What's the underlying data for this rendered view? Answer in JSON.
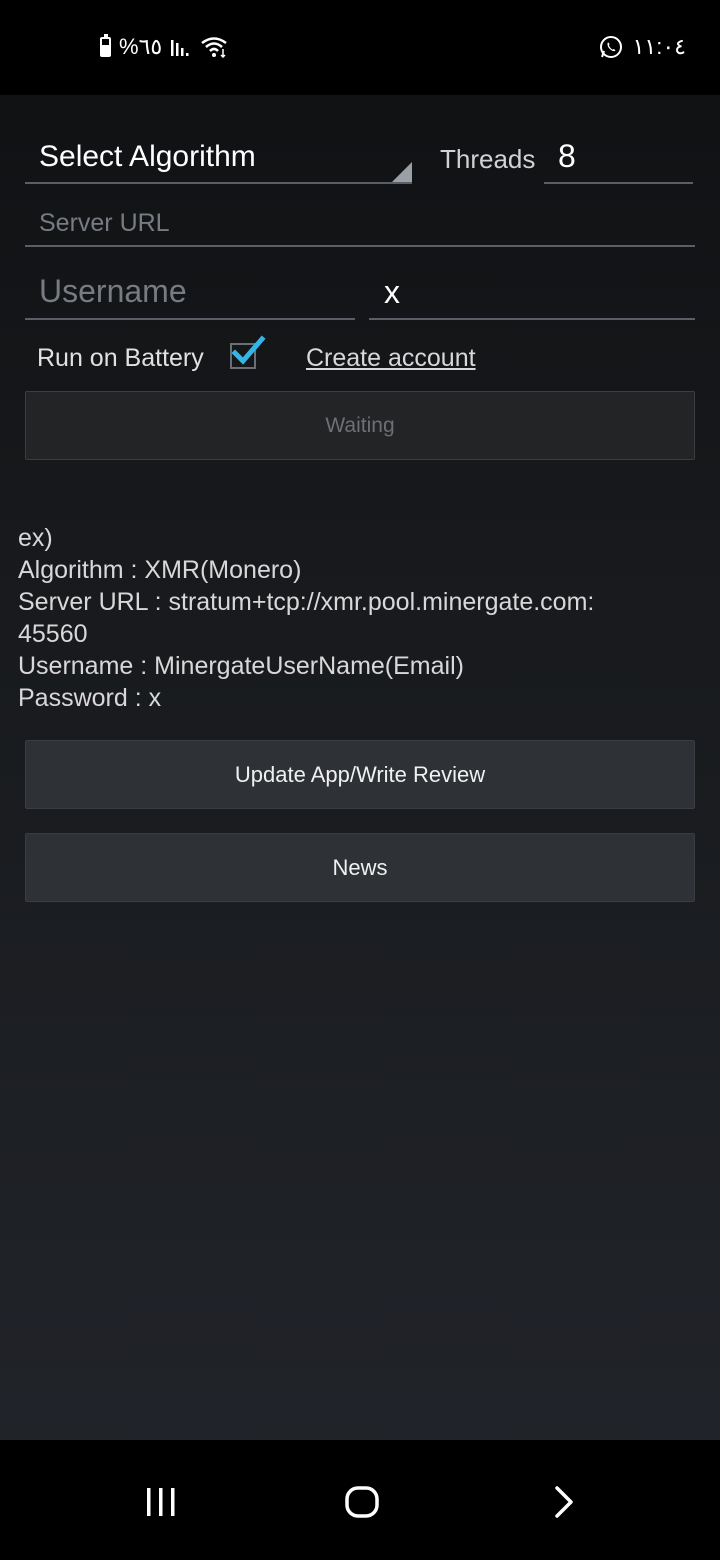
{
  "status_bar": {
    "battery_text": "%٦٥",
    "time": "١١:٠٤",
    "battery_level": 0.65
  },
  "form": {
    "algorithm_select": "Select Algorithm",
    "threads_label": "Threads",
    "threads_value": "8",
    "server_url_placeholder": "Server URL",
    "username_placeholder": "Username",
    "password_value": "x",
    "run_on_battery_label": "Run on Battery",
    "run_on_battery_checked": true,
    "create_account_link": "Create account",
    "status_button": "Waiting"
  },
  "example": {
    "lines": [
      "ex)",
      "Algorithm : XMR(Monero)",
      "Server URL : stratum+tcp://xmr.pool.minergate.com:",
      "45560",
      "Username : MinergateUserName(Email)",
      "Password : x"
    ]
  },
  "actions": {
    "update_button": "Update App/Write Review",
    "news_button": "News"
  },
  "colors": {
    "checkbox_accent": "#33b5e5"
  },
  "nav_bar": {
    "recents_icon": "recents-icon",
    "home_icon": "home-icon",
    "back_icon": "back-icon"
  }
}
